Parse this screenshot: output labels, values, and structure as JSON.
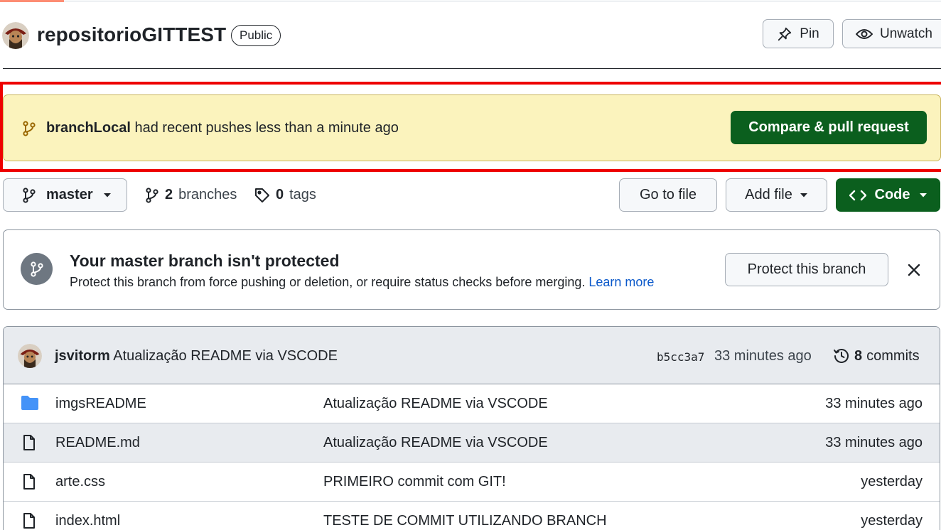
{
  "repo": {
    "name": "repositorioGITTEST",
    "visibility": "Public",
    "pin_label": "Pin",
    "watch_label": "Unwatch"
  },
  "push_banner": {
    "branch": "branchLocal",
    "message": "had recent pushes less than a minute ago",
    "button": "Compare & pull request"
  },
  "branch_bar": {
    "current_branch": "master",
    "branches_count": "2",
    "branches_label": "branches",
    "tags_count": "0",
    "tags_label": "tags",
    "go_to_file": "Go to file",
    "add_file": "Add file",
    "code": "Code"
  },
  "protect": {
    "title": "Your master branch isn't protected",
    "description": "Protect this branch from force pushing or deletion, or require status checks before merging.",
    "learn_more": "Learn more",
    "button": "Protect this branch"
  },
  "latest_commit": {
    "author": "jsvitorm",
    "message": "Atualização README via VSCODE",
    "sha": "b5cc3a7",
    "time": "33 minutes ago",
    "commits_count": "8",
    "commits_label": "commits"
  },
  "files": [
    {
      "type": "folder",
      "name": "imgsREADME",
      "message": "Atualização README via VSCODE",
      "age": "33 minutes ago"
    },
    {
      "type": "file",
      "name": "README.md",
      "message": "Atualização README via VSCODE",
      "age": "33 minutes ago"
    },
    {
      "type": "file",
      "name": "arte.css",
      "message": "PRIMEIRO commit com GIT!",
      "age": "yesterday"
    },
    {
      "type": "file",
      "name": "index.html",
      "message": "TESTE DE COMMIT UTILIZANDO BRANCH",
      "age": "yesterday"
    }
  ],
  "colors": {
    "green": "#0b5f1e",
    "banner_yellow": "#fbf3bd",
    "highlight_red": "#ee0000",
    "folder_blue": "#4493f8",
    "link_blue": "#0a58ca"
  }
}
